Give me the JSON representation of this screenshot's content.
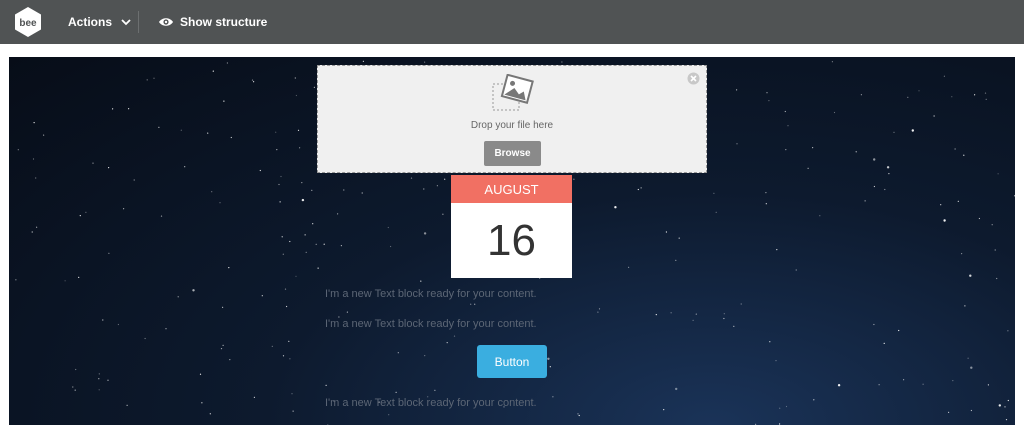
{
  "topbar": {
    "logo_text": "bee",
    "actions_label": "Actions",
    "show_structure_label": "Show structure"
  },
  "dropzone": {
    "drop_text": "Drop your file here",
    "browse_label": "Browse"
  },
  "calendar": {
    "month": "AUGUST",
    "day": "16",
    "month_color": "#f17063"
  },
  "content": {
    "text_block_1": "I'm a new Text block ready for your content.",
    "text_block_2": "I'm a new Text block ready for your content.",
    "button_label": "Button",
    "text_block_3": "I'm a new Text block ready for your content.",
    "button_color": "#3aaee0"
  },
  "icons": {
    "logo": "bee-logo-icon",
    "chevron": "chevron-down-icon",
    "eye": "eye-icon",
    "close": "close-circle-icon",
    "image": "image-placeholder-icon"
  }
}
